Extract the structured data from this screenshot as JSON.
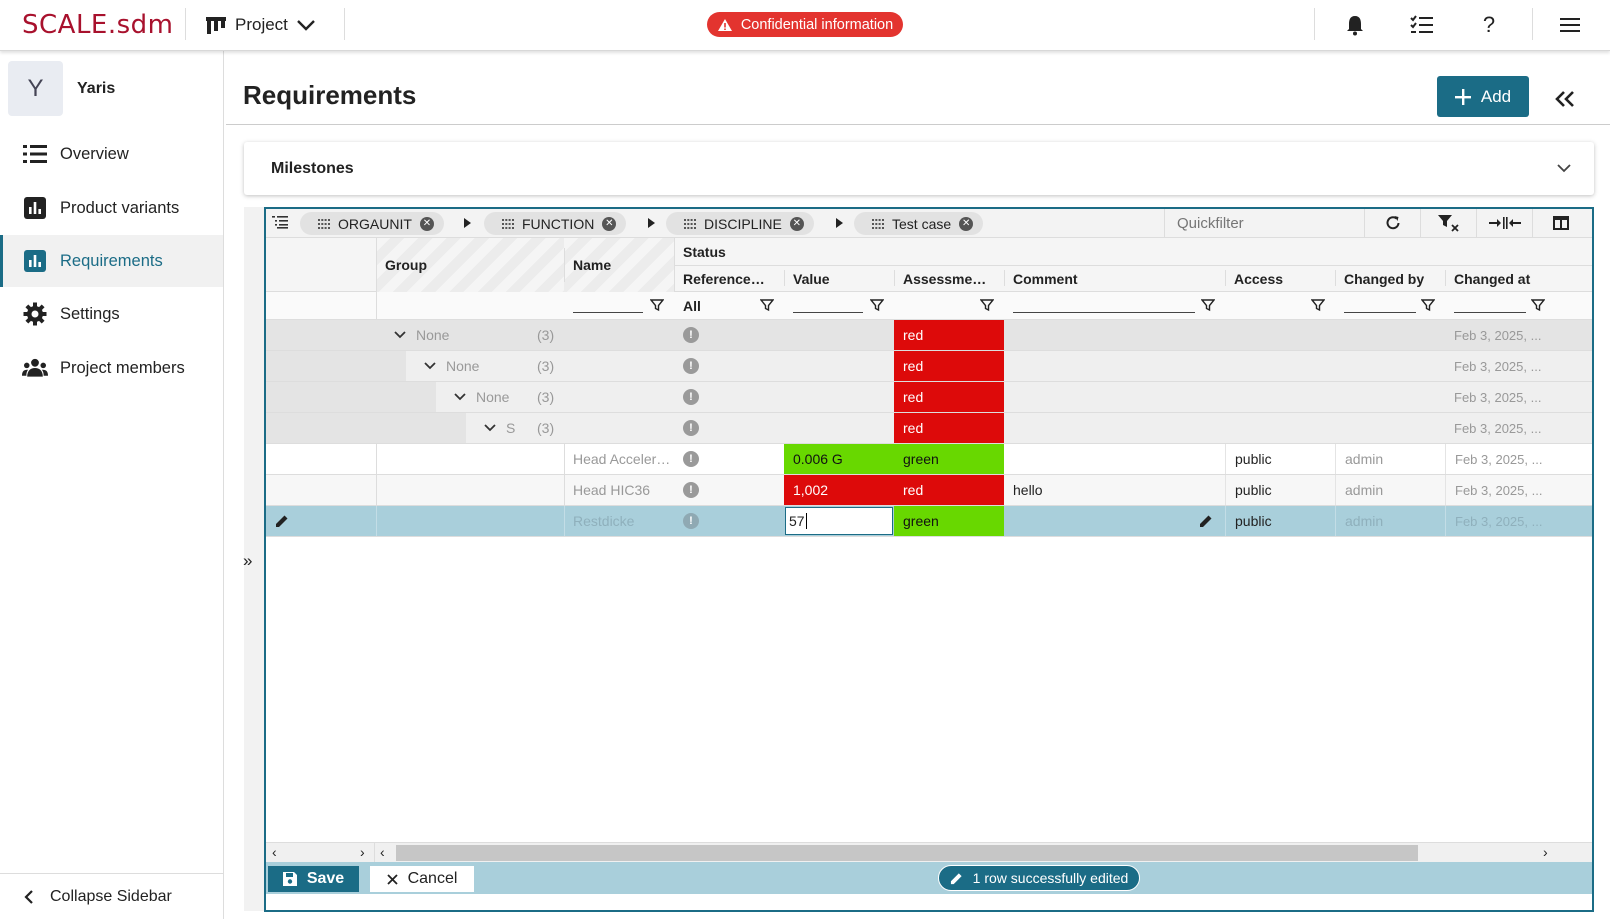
{
  "app": {
    "logo": "SCALE.sdm",
    "project_menu": "Project",
    "confidential": "Confidential information"
  },
  "sidebar": {
    "project_initial": "Y",
    "project_name": "Yaris",
    "items": [
      {
        "label": "Overview",
        "icon": "list-icon"
      },
      {
        "label": "Product variants",
        "icon": "chart-icon"
      },
      {
        "label": "Requirements",
        "icon": "chart-icon",
        "active": true
      },
      {
        "label": "Settings",
        "icon": "gear-icon"
      },
      {
        "label": "Project members",
        "icon": "people-icon"
      }
    ],
    "collapse_label": "Collapse Sidebar"
  },
  "page": {
    "title": "Requirements",
    "add_label": "Add",
    "milestones_label": "Milestones"
  },
  "toolbar": {
    "group_chips": [
      "ORGAUNIT",
      "FUNCTION",
      "DISCIPLINE",
      "Test case"
    ],
    "quickfilter_placeholder": "Quickfilter"
  },
  "columns": {
    "group": "Group",
    "name": "Name",
    "status": "Status",
    "reference": "Reference…",
    "value": "Value",
    "assessment": "Assessme…",
    "comment": "Comment",
    "access": "Access",
    "changed_by": "Changed by",
    "changed_at": "Changed at"
  },
  "filters": {
    "reference": "All"
  },
  "group_rows": [
    {
      "label": "None",
      "count": "(3)",
      "assessment": "red",
      "changed_at": "Feb 3, 2025, ..."
    },
    {
      "label": "None",
      "count": "(3)",
      "assessment": "red",
      "changed_at": "Feb 3, 2025, ..."
    },
    {
      "label": "None",
      "count": "(3)",
      "assessment": "red",
      "changed_at": "Feb 3, 2025, ..."
    },
    {
      "label": "S",
      "count": "(3)",
      "assessment": "red",
      "changed_at": "Feb 3, 2025, ..."
    }
  ],
  "data_rows": [
    {
      "name": "Head Acceler…",
      "value": "0.006 G",
      "assessment": "green",
      "comment": "",
      "access": "public",
      "changed_by": "admin",
      "changed_at": "Feb 3, 2025, ..."
    },
    {
      "name": "Head HIC36",
      "value": "1,002",
      "assessment": "red",
      "comment": "hello",
      "access": "public",
      "changed_by": "admin",
      "changed_at": "Feb 3, 2025, ..."
    },
    {
      "name": "Restdicke",
      "value": "57",
      "assessment": "green",
      "comment": "",
      "access": "public",
      "changed_by": "admin",
      "changed_at": "Feb 3, 2025, ..."
    }
  ],
  "footer": {
    "save_label": "Save",
    "cancel_label": "Cancel",
    "status": "1 row successfully edited"
  },
  "colors": {
    "accent": "#1b6c86",
    "brand": "#a8112d",
    "red": "#dd0a0a",
    "green": "#68d800",
    "confidential": "#e3342f"
  }
}
